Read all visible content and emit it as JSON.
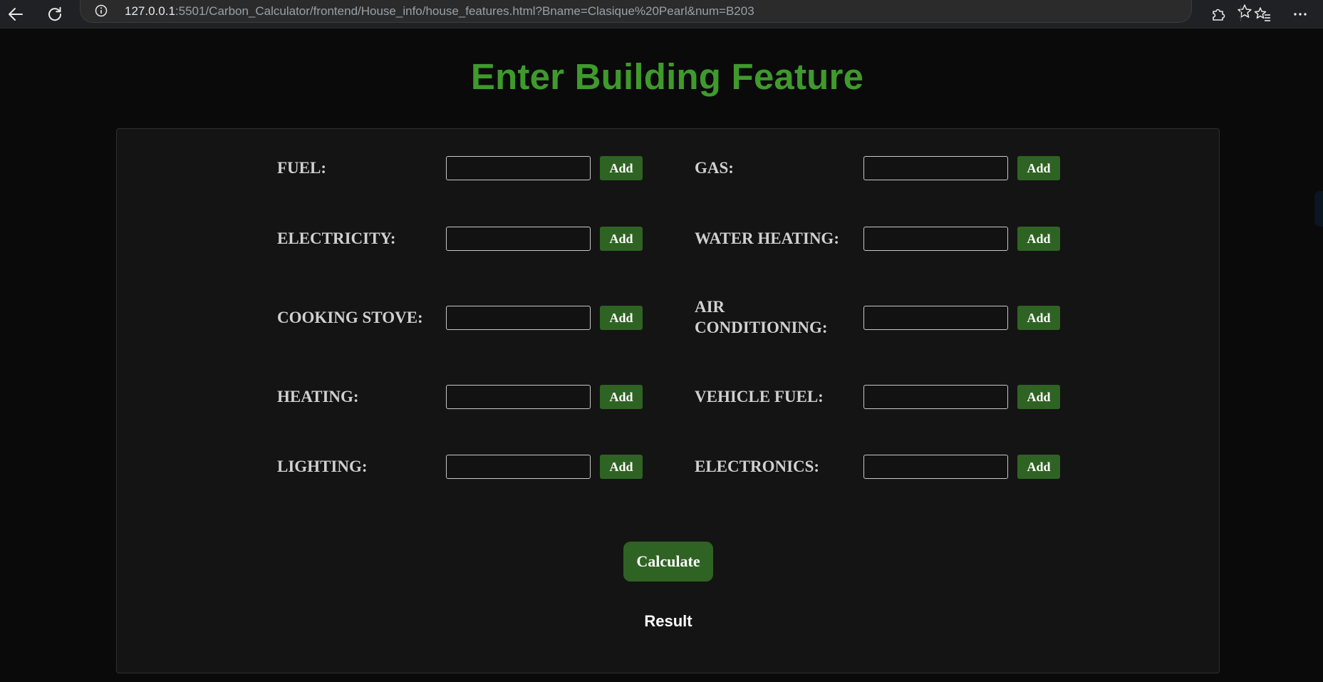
{
  "browser": {
    "url_host": "127.0.0.1",
    "url_rest": ":5501/Carbon_Calculator/frontend/House_info/house_features.html?Bname=Clasique%20Pearl&num=B203"
  },
  "page": {
    "title": "Enter Building Feature",
    "add_label": "Add",
    "calculate_label": "Calculate",
    "result_label": "Result",
    "accent_color": "#3f9a2c",
    "button_color": "#2f6323"
  },
  "fields": {
    "fuel": {
      "label": "FUEL:",
      "value": ""
    },
    "gas": {
      "label": "GAS:",
      "value": ""
    },
    "electricity": {
      "label": "ELECTRICITY:",
      "value": ""
    },
    "water_heating": {
      "label": "WATER HEATING:",
      "value": ""
    },
    "cooking_stove": {
      "label": "COOKING STOVE:",
      "value": ""
    },
    "air_conditioning": {
      "label": "AIR CONDITIONING:",
      "value": ""
    },
    "heating": {
      "label": "HEATING:",
      "value": ""
    },
    "vehicle_fuel": {
      "label": "VEHICLE FUEL:",
      "value": ""
    },
    "lighting": {
      "label": "LIGHTING:",
      "value": ""
    },
    "electronics": {
      "label": "ELECTRONICS:",
      "value": ""
    }
  },
  "icons": {
    "back": "back-arrow-icon",
    "reload": "reload-icon",
    "info": "info-icon",
    "favorite": "star-icon",
    "extensions": "puzzle-icon",
    "favorites": "favorites-icon",
    "more": "more-icon"
  }
}
